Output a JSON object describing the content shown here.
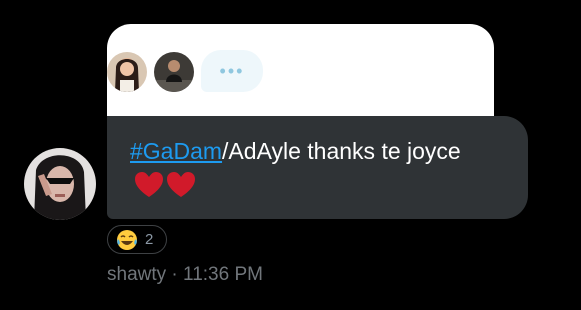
{
  "quoted_card": {
    "typing_indicator": "•••"
  },
  "message": {
    "hashtag": "#GaDam",
    "text": "/AdAyle thanks te joyce",
    "emoji": "red-heart"
  },
  "reaction": {
    "emoji": "face-with-tears-of-joy",
    "count": "2"
  },
  "meta": {
    "sender": "shawty",
    "separator": " · ",
    "time": "11:36 PM"
  },
  "colors": {
    "background": "#000000",
    "bubble": "#2f3336",
    "hashtag": "#1d9bf0",
    "meta_text": "#71767b",
    "heart": "#d11a2a"
  }
}
